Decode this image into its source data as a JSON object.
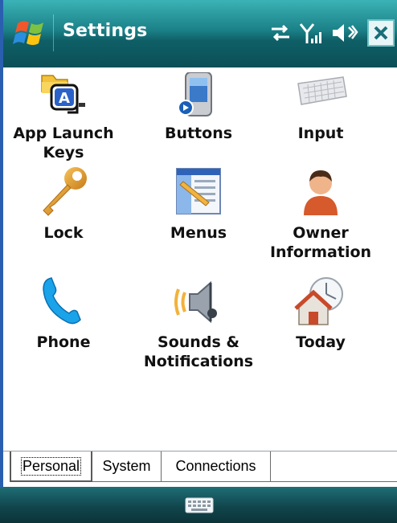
{
  "titlebar": {
    "title": "Settings"
  },
  "items": [
    {
      "label": "App Launch\nKeys",
      "icon": "app-launch-keys-icon"
    },
    {
      "label": "Buttons",
      "icon": "buttons-icon"
    },
    {
      "label": "Input",
      "icon": "input-icon"
    },
    {
      "label": "Lock",
      "icon": "lock-icon"
    },
    {
      "label": "Menus",
      "icon": "menus-icon"
    },
    {
      "label": "Owner\nInformation",
      "icon": "owner-information-icon"
    },
    {
      "label": "Phone",
      "icon": "phone-icon"
    },
    {
      "label": "Sounds &\nNotifications",
      "icon": "sounds-notifications-icon"
    },
    {
      "label": "Today",
      "icon": "today-icon"
    }
  ],
  "tabs": [
    {
      "label": "Personal",
      "active": true
    },
    {
      "label": "System",
      "active": false
    },
    {
      "label": "Connections",
      "active": false
    }
  ],
  "colors": {
    "titlebar": "#1b8087",
    "bottombar": "#11464d",
    "accent": "#2a5fb0"
  }
}
